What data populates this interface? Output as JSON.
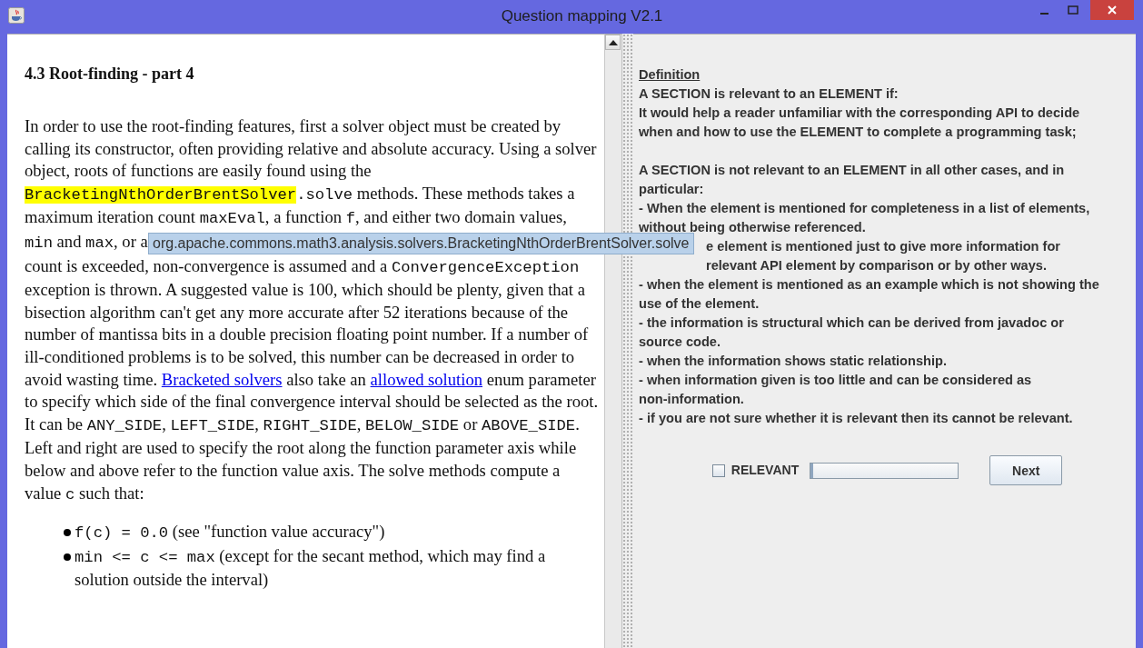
{
  "window": {
    "title": "Question mapping V2.1"
  },
  "document": {
    "heading": "4.3 Root-finding - part 4",
    "lines": [
      [
        {
          "kind": "text",
          "text": "In order to use the root-finding features, first a solver object must be created by"
        }
      ],
      [
        {
          "kind": "text",
          "text": "calling its constructor, often providing relative and absolute accuracy. Using a solver"
        }
      ],
      [
        {
          "kind": "text",
          "text": "object, roots of functions are easily found using the"
        }
      ],
      [
        {
          "kind": "highlight",
          "text": "BracketingNthOrderBrentSolver"
        },
        {
          "kind": "code",
          "text": ".solve"
        },
        {
          "kind": "text",
          "text": " methods. These methods takes a"
        }
      ],
      [
        {
          "kind": "text",
          "text": "maximum iteration count "
        },
        {
          "kind": "code",
          "text": "maxEval"
        },
        {
          "kind": "text",
          "text": ", a function "
        },
        {
          "kind": "code",
          "text": "f"
        },
        {
          "kind": "text",
          "text": ", and either two domain values,"
        }
      ],
      [
        {
          "kind": "code",
          "text": "min"
        },
        {
          "kind": "text",
          "text": " and "
        },
        {
          "kind": "code",
          "text": "max"
        },
        {
          "kind": "text",
          "text": ", or a"
        }
      ],
      [
        {
          "kind": "text",
          "text": "count is exceeded, non-convergence is assumed and a "
        },
        {
          "kind": "code",
          "text": "ConvergenceException"
        }
      ],
      [
        {
          "kind": "text",
          "text": "exception is thrown. A suggested value is 100, which should be plenty, given that a"
        }
      ],
      [
        {
          "kind": "text",
          "text": "bisection algorithm can't get any more accurate after 52 iterations because of the"
        }
      ],
      [
        {
          "kind": "text",
          "text": "number of mantissa bits in a double precision floating point number. If a number of"
        }
      ],
      [
        {
          "kind": "text",
          "text": "ill-conditioned problems is to be solved, this number can be decreased in order to"
        }
      ],
      [
        {
          "kind": "text",
          "text": "avoid wasting time. "
        },
        {
          "kind": "link",
          "text": "Bracketed solvers"
        },
        {
          "kind": "text",
          "text": " also take an "
        },
        {
          "kind": "link",
          "text": "allowed solution"
        },
        {
          "kind": "text",
          "text": " enum parameter"
        }
      ],
      [
        {
          "kind": "text",
          "text": "to specify which side of the final convergence interval should be selected as the root."
        }
      ],
      [
        {
          "kind": "text",
          "text": "It can be "
        },
        {
          "kind": "code",
          "text": "ANY_SIDE"
        },
        {
          "kind": "text",
          "text": ", "
        },
        {
          "kind": "code",
          "text": "LEFT_SIDE"
        },
        {
          "kind": "text",
          "text": ", "
        },
        {
          "kind": "code",
          "text": "RIGHT_SIDE"
        },
        {
          "kind": "text",
          "text": ", "
        },
        {
          "kind": "code",
          "text": "BELOW_SIDE"
        },
        {
          "kind": "text",
          "text": " or "
        },
        {
          "kind": "code",
          "text": "ABOVE_SIDE"
        },
        {
          "kind": "text",
          "text": "."
        }
      ],
      [
        {
          "kind": "text",
          "text": "Left and right are used to specify the root along the function parameter axis while"
        }
      ],
      [
        {
          "kind": "text",
          "text": "below and above refer to the function value axis. The solve methods compute a"
        }
      ],
      [
        {
          "kind": "text",
          "text": "value "
        },
        {
          "kind": "code",
          "text": "c"
        },
        {
          "kind": "text",
          "text": " such that:"
        }
      ]
    ],
    "bullets": [
      {
        "lines": [
          [
            {
              "kind": "code",
              "text": "f(c) = 0.0"
            },
            {
              "kind": "text",
              "text": " (see \"function value accuracy\")"
            }
          ]
        ]
      },
      {
        "lines": [
          [
            {
              "kind": "code",
              "text": "min <= c <= max"
            },
            {
              "kind": "text",
              "text": " (except for the secant method, which may find a"
            }
          ],
          [
            {
              "kind": "text",
              "text": "solution outside the interval)"
            }
          ]
        ]
      }
    ]
  },
  "tooltip": {
    "text": "org.apache.commons.math3.analysis.solvers.BracketingNthOrderBrentSolver.solve"
  },
  "definition": {
    "heading": "Definition",
    "blocks": [
      {
        "kind": "paragraph",
        "covered": false,
        "lines": [
          "A SECTION is relevant to an ELEMENT if:",
          "It would help a reader unfamiliar with the corresponding API to decide",
          "when and how to use the ELEMENT to complete a programming task;"
        ]
      },
      {
        "kind": "intro",
        "covered": false,
        "lines": [
          "A SECTION is not relevant to an ELEMENT in all other cases, and in",
          "particular:"
        ]
      },
      {
        "kind": "item",
        "covered": false,
        "lines": [
          "- When the element is mentioned for completeness in a list of elements,",
          "without being otherwise referenced."
        ]
      },
      {
        "kind": "item",
        "covered": true,
        "lines": [
          "e element is mentioned just to give more information for",
          "relevant API element by comparison or by other ways."
        ]
      },
      {
        "kind": "item",
        "covered": false,
        "lines": [
          "- when the element is mentioned as an example which is not showing the",
          "use of the element."
        ]
      },
      {
        "kind": "item",
        "covered": false,
        "lines": [
          "- the information is structural which can be derived from javadoc or",
          "source code."
        ]
      },
      {
        "kind": "item",
        "covered": false,
        "lines": [
          "- when the information shows static relationship."
        ]
      },
      {
        "kind": "item",
        "covered": false,
        "lines": [
          "- when information given is too little and can be considered as",
          "non-information."
        ]
      },
      {
        "kind": "item",
        "covered": false,
        "lines": [
          "- if you are not sure whether it is relevant then its cannot be relevant."
        ]
      }
    ]
  },
  "relevant_checkbox": {
    "label": "RELEVANT",
    "checked": false
  },
  "progress": {
    "level": 0.02
  },
  "next_button": {
    "label": "Next"
  }
}
